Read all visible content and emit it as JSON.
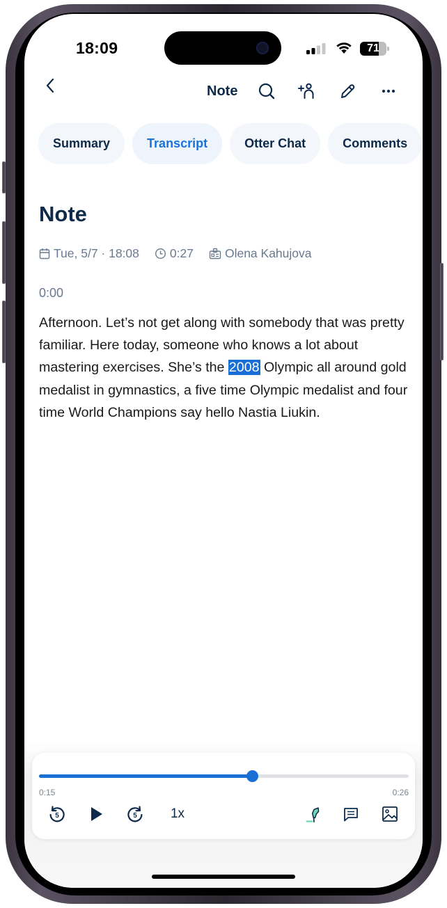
{
  "status_bar": {
    "time": "18:09",
    "battery_percent": 71,
    "battery_label": "71",
    "signal_bars_active": 2,
    "signal_bars_total": 4
  },
  "nav": {
    "back_icon": "chevron-left-icon",
    "title": "Note",
    "actions": [
      {
        "name": "search",
        "icon": "search-icon"
      },
      {
        "name": "share-add-person",
        "icon": "add-person-icon"
      },
      {
        "name": "edit",
        "icon": "pencil-icon"
      },
      {
        "name": "more",
        "icon": "ellipsis-icon"
      }
    ]
  },
  "tabs": [
    {
      "label": "Summary",
      "active": false
    },
    {
      "label": "Transcript",
      "active": true
    },
    {
      "label": "Otter Chat",
      "active": false
    },
    {
      "label": "Comments",
      "active": false
    }
  ],
  "note": {
    "title": "Note",
    "meta": {
      "date": "Tue, 5/7 · 18:08",
      "duration": "0:27",
      "owner": "Olena Kahujova"
    },
    "segment": {
      "timestamp": "0:00",
      "text_before": "Afternoon. Let’s not get along with somebody that was pretty familiar. Here today, someone who knows a lot about mastering exercises. She’s the ",
      "highlighted": "2008",
      "text_after": " Olympic all around gold medalist in gymnastics, a five time Olympic medalist and four time World Champions say hello Nastia Liukin."
    }
  },
  "player": {
    "elapsed": "0:15",
    "remaining": "0:26",
    "progress_fraction": 0.576,
    "rewind_seconds": "5",
    "forward_seconds": "5",
    "speed": "1x",
    "tools": [
      "highlight-icon",
      "comment-icon",
      "image-icon"
    ]
  },
  "colors": {
    "accent": "#1a6fd6",
    "heading": "#0d2a4a",
    "meta": "#6a7a8e",
    "tab_bg": "#f3f6fa",
    "highlighter": "#6fd6b4"
  }
}
